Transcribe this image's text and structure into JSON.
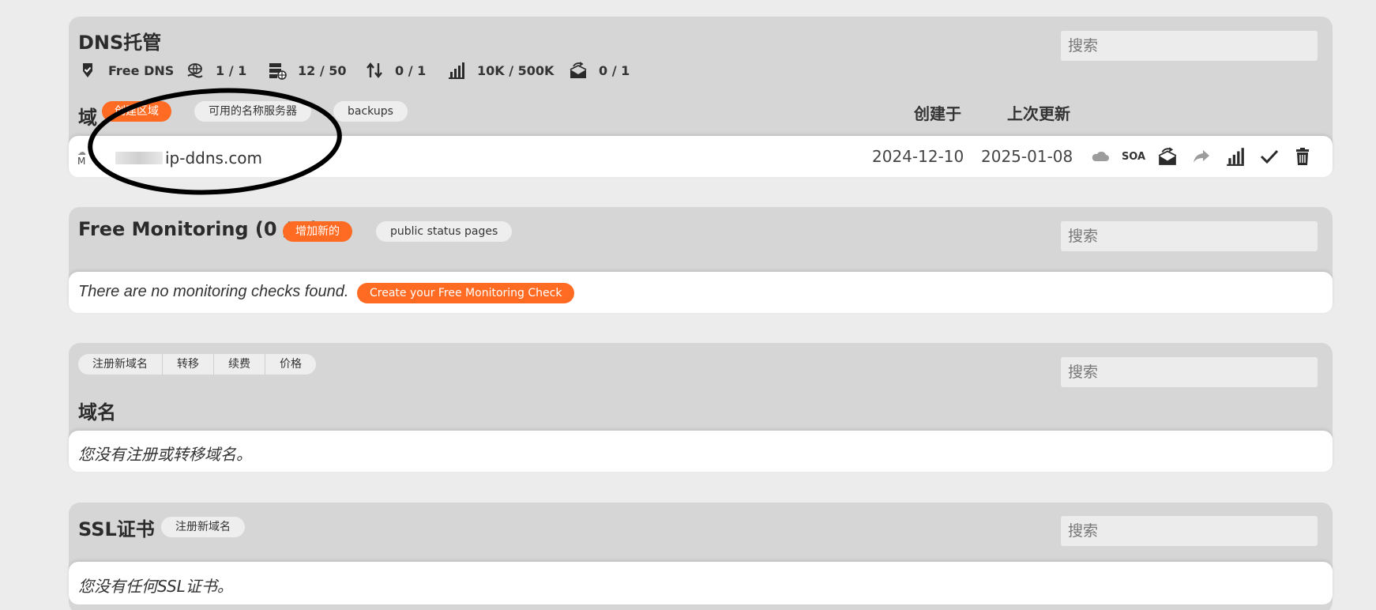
{
  "dns_section": {
    "title": "DNS托管",
    "search_placeholder": "搜索",
    "stats": [
      {
        "icon": "tag-check-icon",
        "value": "Free DNS"
      },
      {
        "icon": "globe-hand-icon",
        "value": "1 / 1"
      },
      {
        "icon": "server-globe-icon",
        "value": "12 / 50"
      },
      {
        "icon": "transfer-arrows-icon",
        "value": "0 / 1"
      },
      {
        "icon": "bar-chart-icon",
        "value": "10K / 500K"
      },
      {
        "icon": "mail-forward-icon",
        "value": "0 / 1"
      }
    ],
    "domain_label": "域",
    "create_zone_label": "创建区域",
    "nameservers_label": "可用的名称服务器",
    "backups_label": "backups",
    "col_created": "创建于",
    "col_updated": "上次更新",
    "zone": {
      "badge": "M",
      "name_prefix": "ip-ddns.com",
      "created": "2024-12-10",
      "updated": "2025-01-08",
      "soa_label": "SOA"
    }
  },
  "monitoring_section": {
    "title": "Free Monitoring (0 / 1)",
    "add_label": "增加新的",
    "status_pages_label": "public status pages",
    "search_placeholder": "搜索",
    "empty_message": "There are no monitoring checks found.",
    "create_label": "Create your Free Monitoring Check"
  },
  "domains_section": {
    "tabs": [
      "注册新域名",
      "转移",
      "续费",
      "价格"
    ],
    "search_placeholder": "搜索",
    "title": "域名",
    "empty_message": "您没有注册或转移域名。"
  },
  "ssl_section": {
    "title": "SSL证书",
    "register_label": "注册新域名",
    "search_placeholder": "搜索",
    "empty_message": "您没有任何SSL证书。"
  },
  "colors": {
    "accent": "#ff6b22",
    "panel": "#d6d6d6",
    "background": "#ececec"
  }
}
